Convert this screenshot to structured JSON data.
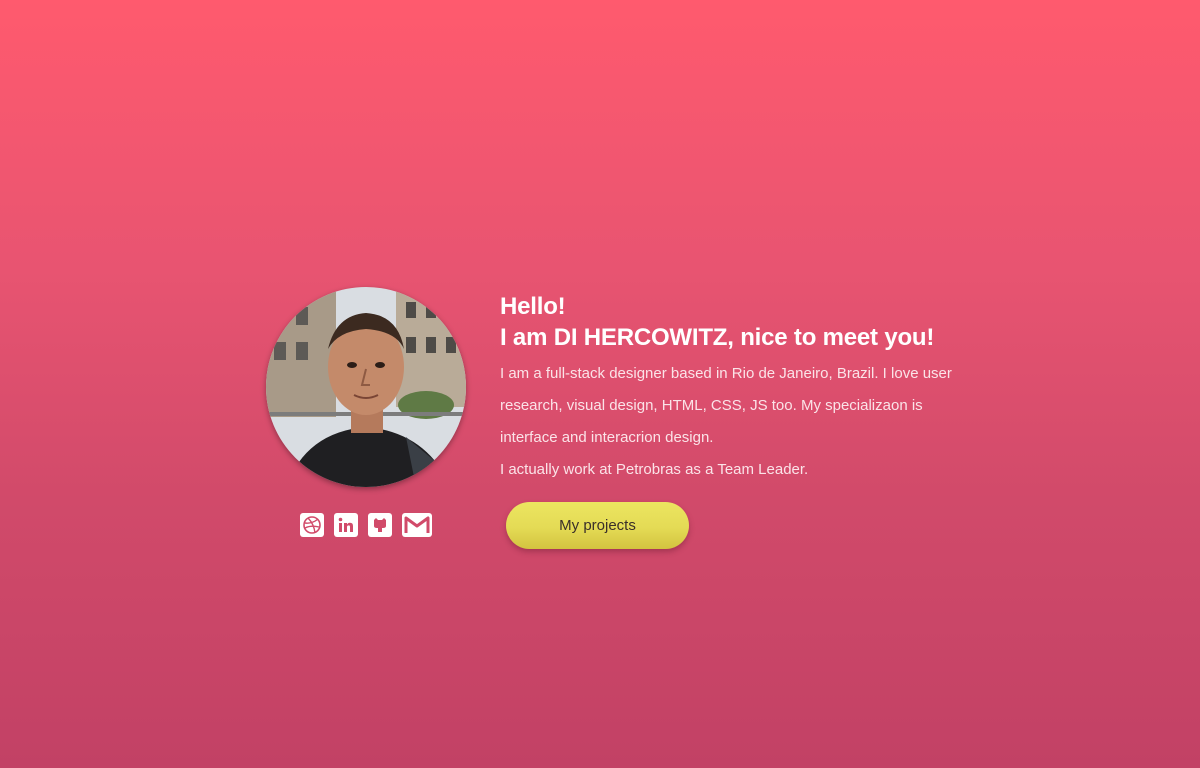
{
  "profile": {
    "avatar_alt": "Profile photo",
    "greeting_line1": "Hello!",
    "greeting_line2": "I am DI HERCOWITZ, nice to meet you!",
    "bio_line1": "I am a full-stack designer based in Rio de Janeiro, Brazil.  I love user",
    "bio_line2": "research, visual design,  HTML, CSS, JS too. My specializaon is",
    "bio_line3": "interface and interacrion design.",
    "bio_line4": "I actually work at Petrobras as a Team Leader."
  },
  "socials": [
    {
      "name": "dribbble",
      "icon": "dribbble-icon"
    },
    {
      "name": "linkedin",
      "icon": "linkedin-icon"
    },
    {
      "name": "github",
      "icon": "github-icon"
    },
    {
      "name": "gmail",
      "icon": "gmail-icon"
    }
  ],
  "cta": {
    "label": "My projects"
  },
  "colors": {
    "background_top": "#ff5a6e",
    "background_bottom": "#c24165",
    "button": "#e4db55",
    "icon": "#d14a6a"
  }
}
